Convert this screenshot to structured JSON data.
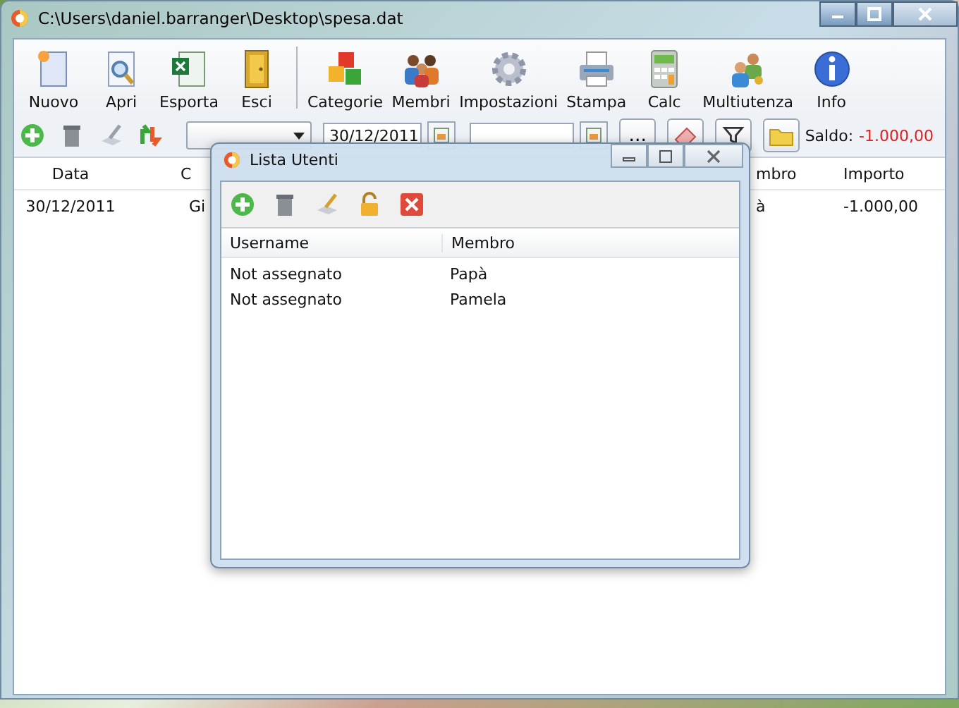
{
  "window": {
    "title": "C:\\Users\\daniel.barranger\\Desktop\\spesa.dat"
  },
  "toolbar_file": [
    {
      "label": "Nuovo"
    },
    {
      "label": "Apri"
    },
    {
      "label": "Esporta"
    },
    {
      "label": "Esci"
    }
  ],
  "toolbar_main": [
    {
      "label": "Categorie"
    },
    {
      "label": "Membri"
    },
    {
      "label": "Impostazioni"
    },
    {
      "label": "Stampa"
    },
    {
      "label": "Calc"
    },
    {
      "label": "Multiutenza"
    },
    {
      "label": "Info"
    }
  ],
  "filter_bar": {
    "date_from": {
      "value": "30/12/2011"
    },
    "more_button": "...",
    "balance": {
      "label": "Saldo:",
      "value": "-1.000,00"
    }
  },
  "table": {
    "columns": [
      "Data",
      "C",
      "mbro",
      "Importo"
    ],
    "rows": [
      [
        "30/12/2011",
        "Gi",
        "à",
        "-1.000,00"
      ]
    ]
  },
  "dialog": {
    "title": "Lista Utenti",
    "table": {
      "columns": [
        "Username",
        "Membro"
      ],
      "rows": [
        [
          "Not assegnato",
          "Papà"
        ],
        [
          "Not assegnato",
          "Pamela"
        ]
      ]
    }
  }
}
